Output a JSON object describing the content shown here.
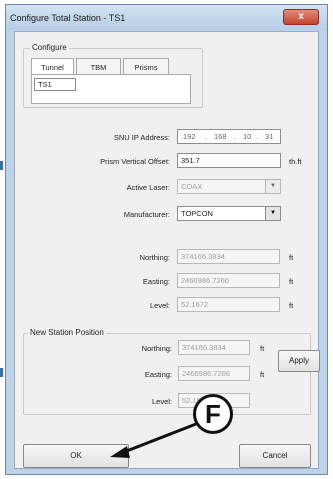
{
  "window": {
    "title": "Configure Total Station - TS1",
    "close_glyph": "x"
  },
  "configure": {
    "label": "Configure",
    "tabs": [
      "Tunnel",
      "TBM",
      "Prisms"
    ],
    "name_value": "TS1"
  },
  "form": {
    "ip_label": "SNU IP Address:",
    "ip_octets": [
      "192",
      "168",
      "10",
      "31"
    ],
    "prism_offset_label": "Prism Vertical Offset:",
    "prism_offset_value": "351.7",
    "prism_offset_unit": "th.ft",
    "active_laser_label": "Active Laser:",
    "active_laser_value": "COAX",
    "manufacturer_label": "Manufacturer:",
    "manufacturer_value": "TOPCON",
    "northing_label": "Northing:",
    "northing_value": "374166.3834",
    "easting_label": "Easting:",
    "easting_value": "2466986.7266",
    "level_label": "Level:",
    "level_value": "52.1672",
    "unit": "ft"
  },
  "new_station": {
    "label": "New Station Position",
    "northing_label": "Northing:",
    "northing_value": "374166.3834",
    "easting_label": "Easting:",
    "easting_value": "2466986.7266",
    "level_label": "Level:",
    "level_value": "52.1672",
    "unit": "ft",
    "apply_label": "Apply"
  },
  "buttons": {
    "ok": "OK",
    "cancel": "Cancel"
  },
  "callout": {
    "letter": "F"
  }
}
